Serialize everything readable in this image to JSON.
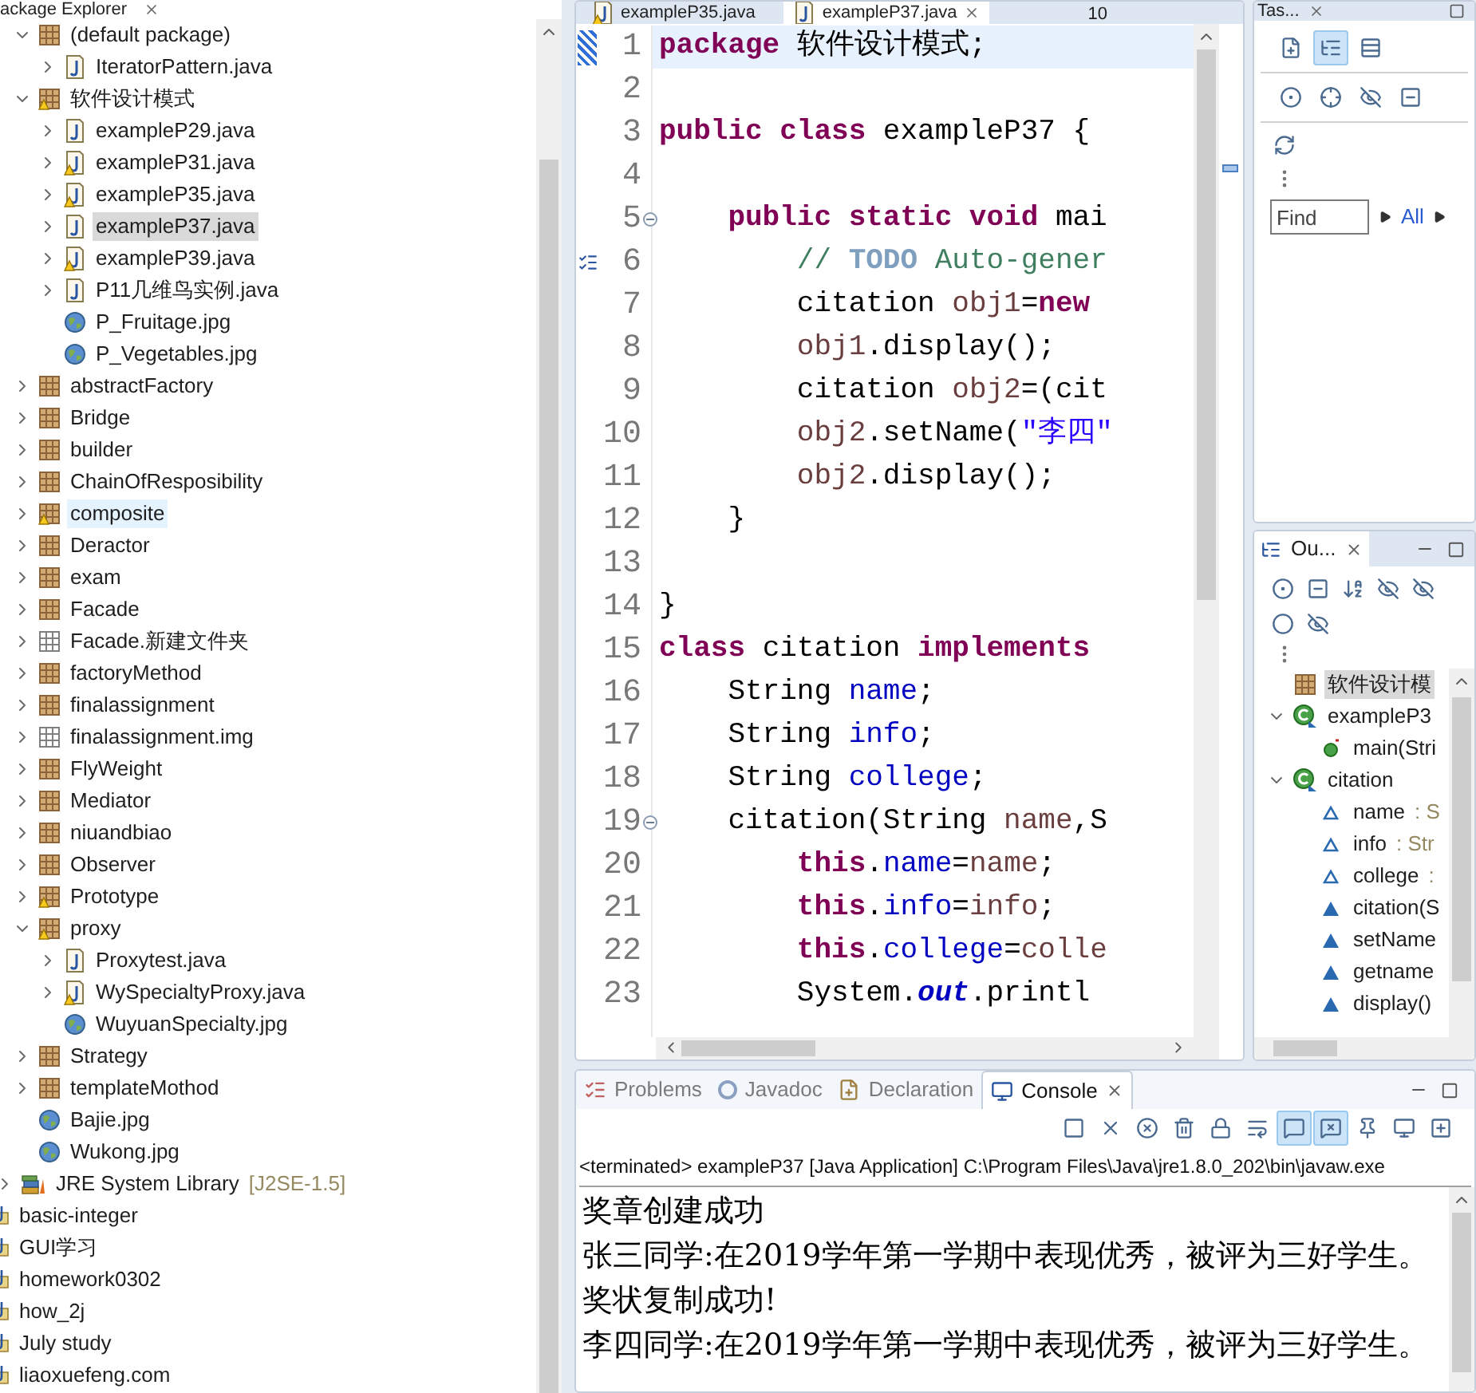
{
  "package_explorer": {
    "title": "ackage Explorer",
    "tree": [
      {
        "children": [
          {
            "children": [
              {
                "label": "(default package)",
                "kind": "package",
                "expanded": true,
                "selected": false,
                "hovered": false,
                "children": [
                  {
                    "label": "IteratorPattern.java",
                    "kind": "java",
                    "expanded": false,
                    "selected": false,
                    "hovered": false
                  }
                ]
              },
              {
                "label": "软件设计模式",
                "kind": "package-warning",
                "expanded": true,
                "selected": false,
                "hovered": false,
                "children": [
                  {
                    "label": "exampleP29.java",
                    "kind": "java",
                    "expanded": false,
                    "selected": false,
                    "hovered": false
                  },
                  {
                    "label": "exampleP31.java",
                    "kind": "java-warning",
                    "expanded": false,
                    "selected": false,
                    "hovered": false
                  },
                  {
                    "label": "exampleP35.java",
                    "kind": "java-warning",
                    "expanded": false,
                    "selected": false,
                    "hovered": false
                  },
                  {
                    "label": "exampleP37.java",
                    "kind": "java",
                    "expanded": false,
                    "selected": true,
                    "hovered": false
                  },
                  {
                    "label": "exampleP39.java",
                    "kind": "java-warning",
                    "expanded": false,
                    "selected": false,
                    "hovered": false
                  },
                  {
                    "label": "P11几维鸟实例.java",
                    "kind": "java",
                    "expanded": false,
                    "selected": false,
                    "hovered": false
                  },
                  {
                    "label": "P_Fruitage.jpg",
                    "kind": "image",
                    "selected": false,
                    "hovered": false
                  },
                  {
                    "label": "P_Vegetables.jpg",
                    "kind": "image",
                    "selected": false,
                    "hovered": false
                  }
                ]
              },
              {
                "label": "abstractFactory",
                "kind": "package",
                "expanded": false,
                "selected": false,
                "hovered": false
              },
              {
                "label": "Bridge",
                "kind": "package",
                "expanded": false,
                "selected": false,
                "hovered": false
              },
              {
                "label": "builder",
                "kind": "package",
                "expanded": false,
                "selected": false,
                "hovered": false
              },
              {
                "label": "ChainOfResposibility",
                "kind": "package",
                "expanded": false,
                "selected": false,
                "hovered": false
              },
              {
                "label": "composite",
                "kind": "package-warning",
                "expanded": false,
                "selected": false,
                "hovered": true
              },
              {
                "label": "Deractor",
                "kind": "package",
                "expanded": false,
                "selected": false,
                "hovered": false
              },
              {
                "label": "exam",
                "kind": "package",
                "expanded": false,
                "selected": false,
                "hovered": false
              },
              {
                "label": "Facade",
                "kind": "package",
                "expanded": false,
                "selected": false,
                "hovered": false
              },
              {
                "label": "Facade.新建文件夹",
                "kind": "empty-package",
                "expanded": false,
                "selected": false,
                "hovered": false
              },
              {
                "label": "factoryMethod",
                "kind": "package",
                "expanded": false,
                "selected": false,
                "hovered": false
              },
              {
                "label": "finalassignment",
                "kind": "package",
                "expanded": false,
                "selected": false,
                "hovered": false
              },
              {
                "label": "finalassignment.img",
                "kind": "empty-package",
                "expanded": false,
                "selected": false,
                "hovered": false
              },
              {
                "label": "FlyWeight",
                "kind": "package",
                "expanded": false,
                "selected": false,
                "hovered": false
              },
              {
                "label": "Mediator",
                "kind": "package",
                "expanded": false,
                "selected": false,
                "hovered": false
              },
              {
                "label": "niuandbiao",
                "kind": "package",
                "expanded": false,
                "selected": false,
                "hovered": false
              },
              {
                "label": "Observer",
                "kind": "package",
                "expanded": false,
                "selected": false,
                "hovered": false
              },
              {
                "label": "Prototype",
                "kind": "package-warning",
                "expanded": false,
                "selected": false,
                "hovered": false
              },
              {
                "label": "proxy",
                "kind": "package-warning",
                "expanded": true,
                "selected": false,
                "hovered": false,
                "children": [
                  {
                    "label": "Proxytest.java",
                    "kind": "java",
                    "expanded": false,
                    "selected": false,
                    "hovered": false
                  },
                  {
                    "label": "WySpecialtyProxy.java",
                    "kind": "java-warning",
                    "expanded": false,
                    "selected": false,
                    "hovered": false
                  },
                  {
                    "label": "WuyuanSpecialty.jpg",
                    "kind": "image",
                    "selected": false,
                    "hovered": false
                  }
                ]
              },
              {
                "label": "Strategy",
                "kind": "package",
                "expanded": false,
                "selected": false,
                "hovered": false
              },
              {
                "label": "templateMothod",
                "kind": "package",
                "expanded": false,
                "selected": false,
                "hovered": false
              },
              {
                "label": "Bajie.jpg",
                "kind": "image",
                "selected": false,
                "hovered": false
              },
              {
                "label": "Wukong.jpg",
                "kind": "image",
                "selected": false,
                "hovered": false
              }
            ]
          },
          {
            "label": "JRE System Library",
            "decoration": "[J2SE-1.5]",
            "kind": "library",
            "expanded": false,
            "selected": false,
            "hovered": false
          }
        ]
      },
      {
        "label": "basic-integer",
        "kind": "project",
        "selected": false,
        "hovered": false
      },
      {
        "label": "GUI学习",
        "kind": "project",
        "selected": false,
        "hovered": false
      },
      {
        "label": "homework0302",
        "kind": "project",
        "selected": false,
        "hovered": false
      },
      {
        "label": "how_2j",
        "kind": "project",
        "selected": false,
        "hovered": false
      },
      {
        "label": "July study",
        "kind": "project",
        "selected": false,
        "hovered": false
      },
      {
        "label": "liaoxuefeng.com",
        "kind": "project",
        "selected": false,
        "hovered": false
      }
    ]
  },
  "editor": {
    "tabs": [
      {
        "label": "exampleP35.java",
        "kind": "java-warning",
        "selected": false
      },
      {
        "label": "exampleP37.java",
        "kind": "java",
        "selected": true
      }
    ],
    "overflow": "10",
    "lines": [
      {
        "number": "1",
        "current": true,
        "changed": true,
        "tokens": [
          {
            "text": "package",
            "kind": "keyword"
          },
          {
            "text": " 软件设计模式;",
            "kind": "plain"
          }
        ]
      },
      {
        "number": "2"
      },
      {
        "number": "3",
        "tokens": [
          {
            "text": "public class",
            "kind": "keyword"
          },
          {
            "text": " exampleP37 {",
            "kind": "plain"
          }
        ]
      },
      {
        "number": "4"
      },
      {
        "number": "5",
        "fold": true,
        "tokens": [
          {
            "text": "    public static void",
            "kind": "keyword"
          },
          {
            "text": " mai",
            "kind": "plain"
          }
        ]
      },
      {
        "number": "6",
        "task": true,
        "tokens": [
          {
            "text": "        //",
            "kind": "comment"
          },
          {
            "text": " TODO",
            "kind": "todo"
          },
          {
            "text": " Auto-gener",
            "kind": "comment"
          }
        ]
      },
      {
        "number": "7",
        "tokens": [
          {
            "text": "        citation ",
            "kind": "plain"
          },
          {
            "text": "obj1",
            "kind": "local"
          },
          {
            "text": "=",
            "kind": "plain"
          },
          {
            "text": "new",
            "kind": "keyword"
          }
        ]
      },
      {
        "number": "8",
        "tokens": [
          {
            "text": "        obj1",
            "kind": "local"
          },
          {
            "text": ".display();",
            "kind": "plain"
          }
        ]
      },
      {
        "number": "9",
        "tokens": [
          {
            "text": "        citation ",
            "kind": "plain"
          },
          {
            "text": "obj2",
            "kind": "local"
          },
          {
            "text": "=(cit",
            "kind": "plain"
          }
        ]
      },
      {
        "number": "10",
        "tokens": [
          {
            "text": "        obj2",
            "kind": "local"
          },
          {
            "text": ".setName(",
            "kind": "plain"
          },
          {
            "text": "\"李四\"",
            "kind": "string"
          }
        ]
      },
      {
        "number": "11",
        "tokens": [
          {
            "text": "        obj2",
            "kind": "local"
          },
          {
            "text": ".display();",
            "kind": "plain"
          }
        ]
      },
      {
        "number": "12",
        "tokens": [
          {
            "text": "    }",
            "kind": "plain"
          }
        ]
      },
      {
        "number": "13"
      },
      {
        "number": "14",
        "tokens": [
          {
            "text": "}",
            "kind": "plain"
          }
        ]
      },
      {
        "number": "15",
        "tokens": [
          {
            "text": "class",
            "kind": "keyword"
          },
          {
            "text": " citation ",
            "kind": "plain"
          },
          {
            "text": "implements",
            "kind": "keyword"
          }
        ]
      },
      {
        "number": "16",
        "tokens": [
          {
            "text": "    String ",
            "kind": "plain"
          },
          {
            "text": "name",
            "kind": "field"
          },
          {
            "text": ";",
            "kind": "plain"
          }
        ]
      },
      {
        "number": "17",
        "tokens": [
          {
            "text": "    String ",
            "kind": "plain"
          },
          {
            "text": "info",
            "kind": "field"
          },
          {
            "text": ";",
            "kind": "plain"
          }
        ]
      },
      {
        "number": "18",
        "tokens": [
          {
            "text": "    String ",
            "kind": "plain"
          },
          {
            "text": "college",
            "kind": "field"
          },
          {
            "text": ";",
            "kind": "plain"
          }
        ]
      },
      {
        "number": "19",
        "fold": true,
        "tokens": [
          {
            "text": "    citation(String ",
            "kind": "plain"
          },
          {
            "text": "name",
            "kind": "local"
          },
          {
            "text": ",S",
            "kind": "plain"
          }
        ]
      },
      {
        "number": "20",
        "tokens": [
          {
            "text": "        this",
            "kind": "keyword"
          },
          {
            "text": ".",
            "kind": "plain"
          },
          {
            "text": "name",
            "kind": "field"
          },
          {
            "text": "=",
            "kind": "plain"
          },
          {
            "text": "name",
            "kind": "local"
          },
          {
            "text": ";",
            "kind": "plain"
          }
        ]
      },
      {
        "number": "21",
        "tokens": [
          {
            "text": "        this",
            "kind": "keyword"
          },
          {
            "text": ".",
            "kind": "plain"
          },
          {
            "text": "info",
            "kind": "field"
          },
          {
            "text": "=",
            "kind": "plain"
          },
          {
            "text": "info",
            "kind": "local"
          },
          {
            "text": ";",
            "kind": "plain"
          }
        ]
      },
      {
        "number": "22",
        "tokens": [
          {
            "text": "        this",
            "kind": "keyword"
          },
          {
            "text": ".",
            "kind": "plain"
          },
          {
            "text": "college",
            "kind": "field"
          },
          {
            "text": "=",
            "kind": "plain"
          },
          {
            "text": "colle",
            "kind": "local"
          }
        ]
      },
      {
        "number": "23",
        "tokens": [
          {
            "text": "        System.",
            "kind": "plain"
          },
          {
            "text": "out",
            "kind": "static"
          },
          {
            "text": ".printl",
            "kind": "plain"
          }
        ]
      }
    ]
  },
  "task_list": {
    "title": "Tas...",
    "toolbar": [
      {
        "kind": "new-task",
        "pressed": false
      },
      {
        "kind": "categorized",
        "pressed": true
      },
      {
        "kind": "scheduled",
        "pressed": false
      },
      {
        "kind": "show-all",
        "pressed": false
      },
      {
        "kind": "focus",
        "pressed": false
      },
      {
        "kind": "hide-completed",
        "pressed": false
      },
      {
        "kind": "collapse",
        "pressed": false
      },
      {
        "kind": "sync",
        "pressed": false
      }
    ],
    "find": {
      "placeholder": "Find"
    },
    "filter_link": "All"
  },
  "outline": {
    "title": "Ou...",
    "tree": [
      {
        "label": "软件设计模",
        "kind": "package",
        "selected": true
      },
      {
        "label": "exampleP3",
        "kind": "class",
        "expanded": true,
        "selected": false,
        "children": [
          {
            "label": "main(Stri",
            "kind": "public-method",
            "selected": false
          }
        ]
      },
      {
        "label": "citation",
        "kind": "class",
        "expanded": true,
        "selected": false,
        "children": [
          {
            "label": "name",
            "type": ": S",
            "kind": "field",
            "selected": false
          },
          {
            "label": "info",
            "type": ": Str",
            "kind": "field",
            "selected": false
          },
          {
            "label": "college",
            "type": ":",
            "kind": "field",
            "selected": false
          },
          {
            "label": "citation(S",
            "kind": "method",
            "selected": false
          },
          {
            "label": "setName",
            "kind": "method",
            "selected": false
          },
          {
            "label": "getname",
            "kind": "method",
            "selected": false
          },
          {
            "label": "display()",
            "kind": "method",
            "selected": false
          }
        ]
      }
    ]
  },
  "console": {
    "tabs": [
      {
        "label": "Problems",
        "kind": "problems",
        "selected": false
      },
      {
        "label": "Javadoc",
        "kind": "at",
        "selected": false
      },
      {
        "label": "Declaration",
        "kind": "declaration",
        "selected": false
      },
      {
        "label": "Console",
        "kind": "console",
        "selected": true
      }
    ],
    "toolbar": [
      {
        "kind": "stop",
        "pressed": false
      },
      {
        "kind": "remove",
        "pressed": false
      },
      {
        "kind": "remove-all",
        "pressed": false
      },
      {
        "kind": "clear",
        "pressed": false
      },
      {
        "kind": "lock",
        "pressed": false
      },
      {
        "kind": "wrap",
        "pressed": false
      },
      {
        "kind": "stdout",
        "pressed": true
      },
      {
        "kind": "stderr",
        "pressed": true
      },
      {
        "kind": "pin",
        "pressed": false
      },
      {
        "kind": "display",
        "pressed": false
      },
      {
        "kind": "open",
        "pressed": false
      }
    ],
    "status": "<terminated> exampleP37 [Java Application] C:\\Program Files\\Java\\jre1.8.0_202\\bin\\javaw.exe",
    "output": [
      "奖章创建成功",
      "张三同学:在2019学年第一学期中表现优秀，被评为三好学生。",
      "奖状复制成功!",
      "李四同学:在2019学年第一学期中表现优秀，被评为三好学生。"
    ]
  }
}
